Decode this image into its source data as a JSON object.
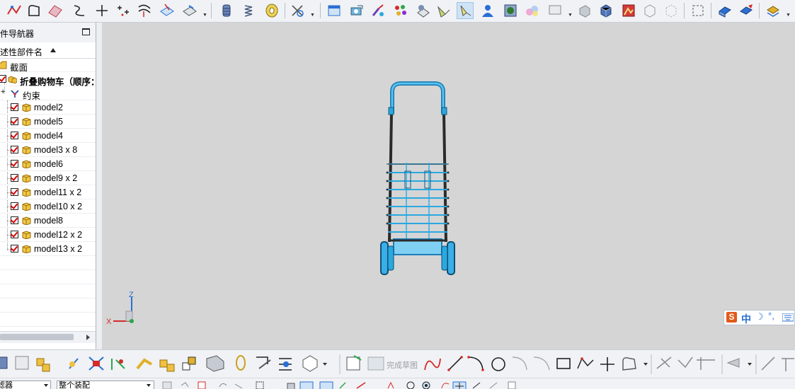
{
  "navigator": {
    "title": "部件导航器",
    "column_title": "描述性部件名",
    "rows": [
      {
        "label": "截面",
        "kind": "folder"
      },
      {
        "label": "折叠购物车（顺序：",
        "kind": "assembly",
        "checked": true,
        "bold": true
      },
      {
        "label": "约束",
        "kind": "constraints"
      },
      {
        "label": "model2",
        "kind": "part",
        "checked": true
      },
      {
        "label": "model5",
        "kind": "part",
        "checked": true
      },
      {
        "label": "model4",
        "kind": "part",
        "checked": true
      },
      {
        "label": "model3 x 8",
        "kind": "part",
        "checked": true
      },
      {
        "label": "model6",
        "kind": "part",
        "checked": true
      },
      {
        "label": "model9 x 2",
        "kind": "part",
        "checked": true
      },
      {
        "label": "model11 x 2",
        "kind": "part",
        "checked": true
      },
      {
        "label": "model10 x 2",
        "kind": "part",
        "checked": true
      },
      {
        "label": "model8",
        "kind": "part",
        "checked": true
      },
      {
        "label": "model12 x 2",
        "kind": "part",
        "checked": true
      },
      {
        "label": "model13 x 2",
        "kind": "part",
        "checked": true
      }
    ]
  },
  "toolbar_top": {
    "icons": [
      "curve-icon",
      "sketch-icon",
      "surface-icon",
      "spline-icon",
      "point-icon",
      "point-set-icon",
      "offset-curve-icon",
      "project-icon",
      "extract-icon",
      "cylinder-icon",
      "spring-icon",
      "bearing-icon",
      "pattern-icon",
      "render-icon",
      "camera-icon",
      "paint-icon",
      "palette-icon",
      "material-icon",
      "light-icon",
      "spotlight-icon",
      "person-icon",
      "studio-icon",
      "blend-icon",
      "display-icon",
      "shade-icon",
      "cube-icon",
      "image-icon",
      "wire-icon",
      "hidden-icon",
      "box-icon",
      "view-icon",
      "edit-view-icon",
      "layer-icon"
    ],
    "active_icon": "spotlight-icon"
  },
  "toolbar_bottom": {
    "finish_sketch_label": "完成草图"
  },
  "status_bar": {
    "filter_label": "过滤器",
    "scope_value": "整个装配"
  },
  "viewport": {
    "background": "#d5d5d5",
    "model_color": "#29a8e0",
    "triad": {
      "z_label": "Z",
      "x_label": "X",
      "y_label": "Y"
    }
  },
  "ime": {
    "logo_label": "S",
    "lang_label": "中"
  },
  "colors": {
    "toolbar_bg": "#f0f2f5",
    "check_red": "#d40000",
    "axis_blue": "#2a6fd4",
    "axis_red": "#d42a2a"
  }
}
